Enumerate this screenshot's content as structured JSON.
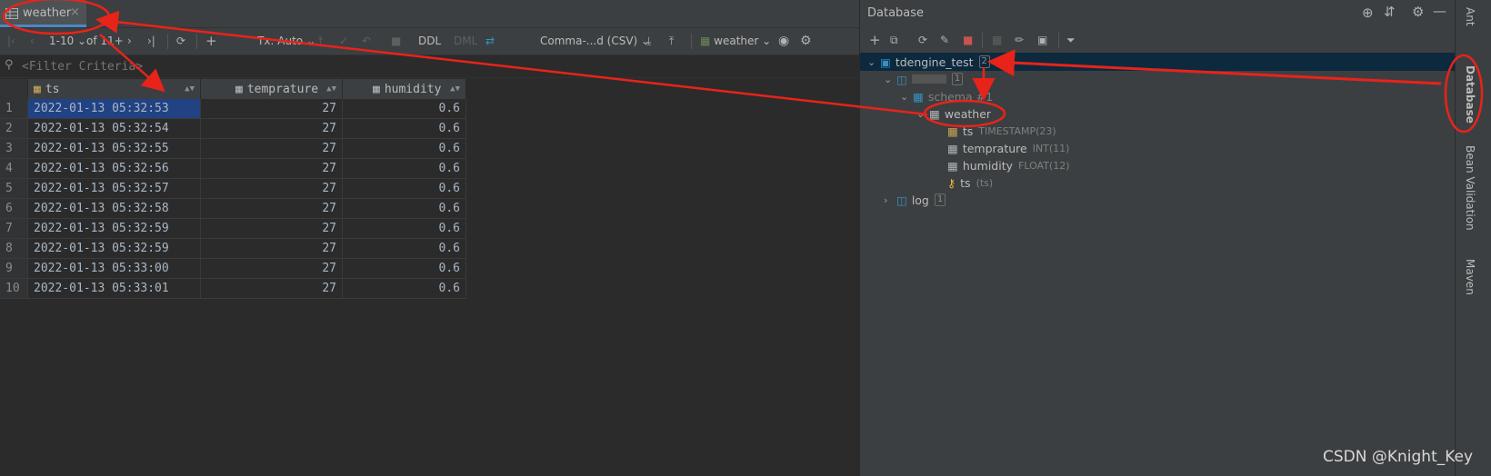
{
  "editor_tab": {
    "label": "weather",
    "close": "×"
  },
  "toolbar": {
    "page_range": "1-10",
    "of_count": "of 11+",
    "tx_mode": "Tx: Auto",
    "ddl": "DDL",
    "dml": "DML",
    "export_format": "Comma-...d (CSV)",
    "table_selector": "weather"
  },
  "filter": {
    "placeholder": "<Filter Criteria>"
  },
  "grid": {
    "columns": [
      "ts",
      "temprature",
      "humidity"
    ],
    "rows": [
      [
        "1",
        "2022-01-13 05:32:53",
        "27",
        "0.6"
      ],
      [
        "2",
        "2022-01-13 05:32:54",
        "27",
        "0.6"
      ],
      [
        "3",
        "2022-01-13 05:32:55",
        "27",
        "0.6"
      ],
      [
        "4",
        "2022-01-13 05:32:56",
        "27",
        "0.6"
      ],
      [
        "5",
        "2022-01-13 05:32:57",
        "27",
        "0.6"
      ],
      [
        "6",
        "2022-01-13 05:32:58",
        "27",
        "0.6"
      ],
      [
        "7",
        "2022-01-13 05:32:59",
        "27",
        "0.6"
      ],
      [
        "8",
        "2022-01-13 05:32:59",
        "27",
        "0.6"
      ],
      [
        "9",
        "2022-01-13 05:33:00",
        "27",
        "0.6"
      ],
      [
        "10",
        "2022-01-13 05:33:01",
        "27",
        "0.6"
      ]
    ]
  },
  "db_panel": {
    "title": "Database",
    "tree": {
      "root": {
        "label": "tdengine_test",
        "badge": "2"
      },
      "db": {
        "label": "",
        "badge": "1"
      },
      "schema": {
        "label": "schema #1"
      },
      "table": {
        "label": "weather"
      },
      "columns": [
        {
          "label": "ts",
          "type": "TIMESTAMP(23)"
        },
        {
          "label": "temprature",
          "type": "INT(11)"
        },
        {
          "label": "humidity",
          "type": "FLOAT(12)"
        }
      ],
      "key": {
        "label": "ts",
        "meta": "(ts)"
      },
      "log": {
        "label": "log",
        "badge": "1"
      }
    }
  },
  "side_tabs": {
    "ant": "Ant",
    "database": "Database",
    "bean": "Bean Validation",
    "maven": "Maven"
  },
  "watermark": "CSDN @Knight_Key",
  "colors": {
    "annotation_red": "#e8231a",
    "selection": "#214283",
    "tree_selection": "#0d293e"
  }
}
